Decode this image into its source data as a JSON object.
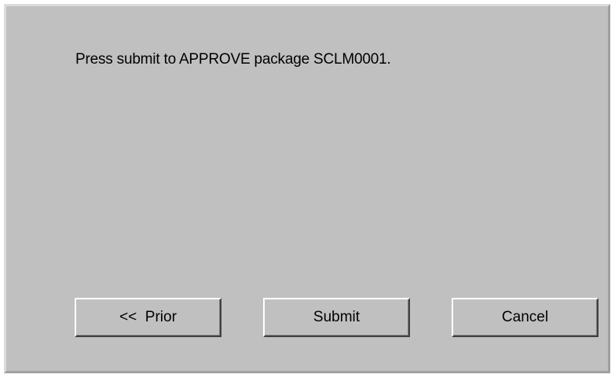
{
  "dialog": {
    "message": "Press submit to APPROVE package SCLM0001."
  },
  "buttons": {
    "prior_label": "<<  Prior",
    "submit_label": "Submit",
    "cancel_label": "Cancel"
  }
}
